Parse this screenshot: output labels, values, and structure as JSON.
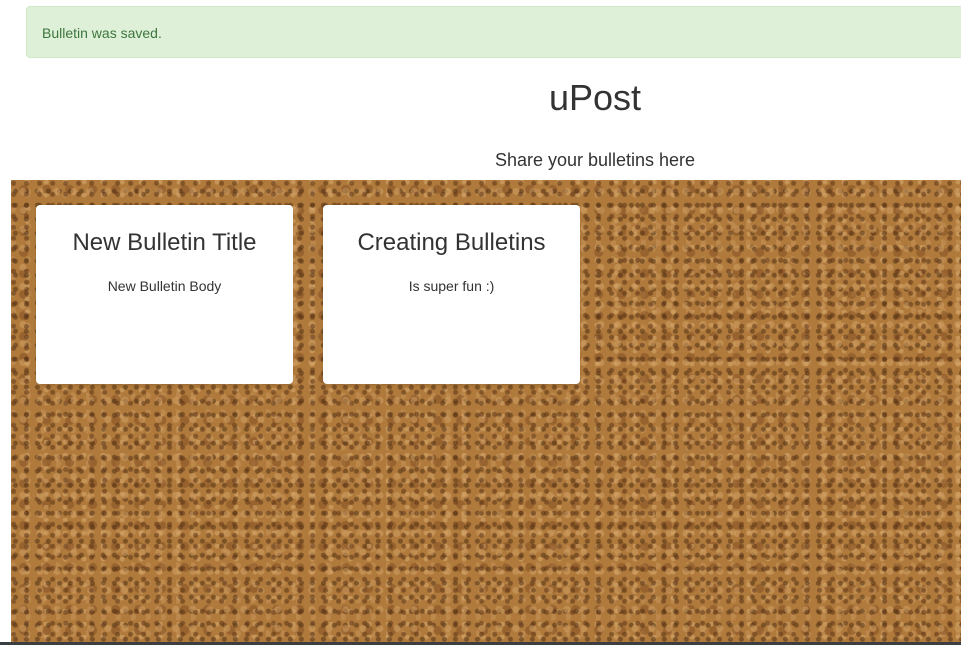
{
  "alert": {
    "message": "Bulletin was saved."
  },
  "header": {
    "title": "uPost",
    "subtitle": "Share your bulletins here"
  },
  "bulletins": [
    {
      "title": "New Bulletin Title",
      "body": "New Bulletin Body"
    },
    {
      "title": "Creating Bulletins",
      "body": "Is super fun :)"
    }
  ],
  "colors": {
    "alert_background": "#dff0d8",
    "alert_text": "#3c763d",
    "board": "#b07a3c",
    "card": "#ffffff"
  }
}
